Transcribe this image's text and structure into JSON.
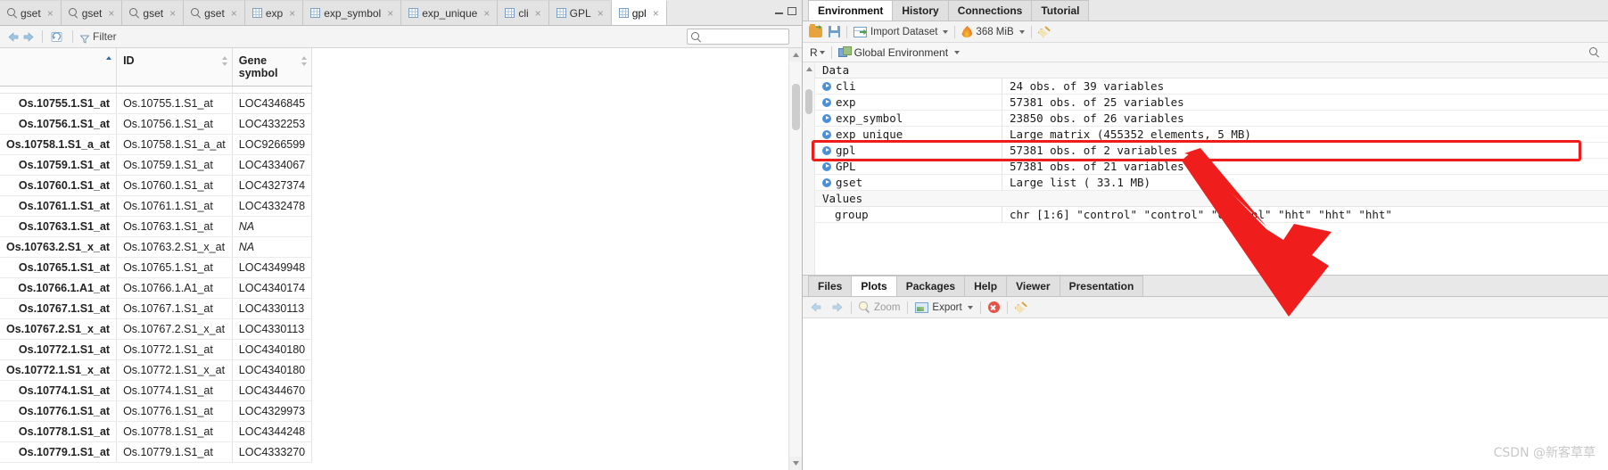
{
  "source_pane": {
    "tabs": [
      {
        "label": "gset",
        "icon": "search-icon",
        "active": false
      },
      {
        "label": "gset",
        "icon": "search-icon",
        "active": false
      },
      {
        "label": "gset",
        "icon": "search-icon",
        "active": false
      },
      {
        "label": "gset",
        "icon": "search-icon",
        "active": false
      },
      {
        "label": "exp",
        "icon": "grid-icon",
        "active": false
      },
      {
        "label": "exp_symbol",
        "icon": "grid-icon",
        "active": false
      },
      {
        "label": "exp_unique",
        "icon": "grid-icon",
        "active": false
      },
      {
        "label": "cli",
        "icon": "grid-icon",
        "active": false
      },
      {
        "label": "GPL",
        "icon": "grid-icon",
        "active": false
      },
      {
        "label": "gpl",
        "icon": "grid-icon",
        "active": true
      }
    ],
    "close_glyph": "×",
    "toolbar": {
      "filter_label": "Filter",
      "back_icon": "back-arrow-icon",
      "forward_icon": "forward-arrow-icon",
      "refresh_icon": "refresh-icon",
      "funnel_icon": "funnel-icon"
    },
    "search": {
      "value": "",
      "placeholder": ""
    },
    "window_controls": {
      "minimize": "minimize-icon",
      "maximize": "maximize-icon"
    },
    "grid": {
      "columns": [
        "",
        "ID",
        "Gene symbol"
      ],
      "sort_column": 0,
      "sort_direction": "asc",
      "rows": [
        {
          "rowname": "Os.10755.1.S1_at",
          "id": "Os.10755.1.S1_at",
          "symbol": "LOC4346845",
          "na": false
        },
        {
          "rowname": "Os.10756.1.S1_at",
          "id": "Os.10756.1.S1_at",
          "symbol": "LOC4332253",
          "na": false
        },
        {
          "rowname": "Os.10758.1.S1_a_at",
          "id": "Os.10758.1.S1_a_at",
          "symbol": "LOC9266599",
          "na": false
        },
        {
          "rowname": "Os.10759.1.S1_at",
          "id": "Os.10759.1.S1_at",
          "symbol": "LOC4334067",
          "na": false
        },
        {
          "rowname": "Os.10760.1.S1_at",
          "id": "Os.10760.1.S1_at",
          "symbol": "LOC4327374",
          "na": false
        },
        {
          "rowname": "Os.10761.1.S1_at",
          "id": "Os.10761.1.S1_at",
          "symbol": "LOC4332478",
          "na": false
        },
        {
          "rowname": "Os.10763.1.S1_at",
          "id": "Os.10763.1.S1_at",
          "symbol": "NA",
          "na": true
        },
        {
          "rowname": "Os.10763.2.S1_x_at",
          "id": "Os.10763.2.S1_x_at",
          "symbol": "NA",
          "na": true
        },
        {
          "rowname": "Os.10765.1.S1_at",
          "id": "Os.10765.1.S1_at",
          "symbol": "LOC4349948",
          "na": false
        },
        {
          "rowname": "Os.10766.1.A1_at",
          "id": "Os.10766.1.A1_at",
          "symbol": "LOC4340174",
          "na": false
        },
        {
          "rowname": "Os.10767.1.S1_at",
          "id": "Os.10767.1.S1_at",
          "symbol": "LOC4330113",
          "na": false
        },
        {
          "rowname": "Os.10767.2.S1_x_at",
          "id": "Os.10767.2.S1_x_at",
          "symbol": "LOC4330113",
          "na": false
        },
        {
          "rowname": "Os.10772.1.S1_at",
          "id": "Os.10772.1.S1_at",
          "symbol": "LOC4340180",
          "na": false
        },
        {
          "rowname": "Os.10772.1.S1_x_at",
          "id": "Os.10772.1.S1_x_at",
          "symbol": "LOC4340180",
          "na": false
        },
        {
          "rowname": "Os.10774.1.S1_at",
          "id": "Os.10774.1.S1_at",
          "symbol": "LOC4344670",
          "na": false
        },
        {
          "rowname": "Os.10776.1.S1_at",
          "id": "Os.10776.1.S1_at",
          "symbol": "LOC4329973",
          "na": false
        },
        {
          "rowname": "Os.10778.1.S1_at",
          "id": "Os.10778.1.S1_at",
          "symbol": "LOC4344248",
          "na": false
        },
        {
          "rowname": "Os.10779.1.S1_at",
          "id": "Os.10779.1.S1_at",
          "symbol": "LOC4333270",
          "na": false
        }
      ]
    }
  },
  "environment_pane": {
    "tabs": [
      {
        "label": "Environment",
        "active": true
      },
      {
        "label": "History",
        "active": false
      },
      {
        "label": "Connections",
        "active": false
      },
      {
        "label": "Tutorial",
        "active": false
      }
    ],
    "toolbar": {
      "open_icon": "open-folder-icon",
      "save_icon": "save-icon",
      "import_label": "Import Dataset",
      "import_icon": "import-dataset-icon",
      "memory_label": "368 MiB",
      "memory_icon": "memory-flame-icon",
      "clear_icon": "broom-icon"
    },
    "scope": {
      "language": "R",
      "environment_label": "Global Environment",
      "environment_icon": "cube-icon",
      "search_icon": "search-icon"
    },
    "sections": [
      {
        "name": "Data",
        "items": [
          {
            "name": "cli",
            "value": "24 obs. of 39 variables",
            "expandable": true,
            "highlighted": false
          },
          {
            "name": "exp",
            "value": "57381 obs. of 25 variables",
            "expandable": true,
            "highlighted": false
          },
          {
            "name": "exp_symbol",
            "value": "23850 obs. of 26 variables",
            "expandable": true,
            "highlighted": false
          },
          {
            "name": "exp_unique",
            "value": "Large matrix (455352 elements,  5 MB)",
            "expandable": true,
            "highlighted": false
          },
          {
            "name": "gpl",
            "value": "57381 obs. of 2 variables",
            "expandable": true,
            "highlighted": true
          },
          {
            "name": "GPL",
            "value": "57381 obs. of 21 variables",
            "expandable": true,
            "highlighted": false
          },
          {
            "name": "gset",
            "value": "Large list ( 33.1 MB)",
            "expandable": true,
            "highlighted": false
          }
        ]
      },
      {
        "name": "Values",
        "items": [
          {
            "name": "group",
            "value": "chr [1:6] \"control\" \"control\" \"control\" \"hht\" \"hht\" \"hht\"",
            "expandable": false,
            "highlighted": false
          }
        ]
      }
    ]
  },
  "plots_pane": {
    "tabs": [
      {
        "label": "Files",
        "active": false
      },
      {
        "label": "Plots",
        "active": true
      },
      {
        "label": "Packages",
        "active": false
      },
      {
        "label": "Help",
        "active": false
      },
      {
        "label": "Viewer",
        "active": false
      },
      {
        "label": "Presentation",
        "active": false
      }
    ],
    "toolbar": {
      "back_icon": "back-arrow-icon",
      "forward_icon": "forward-arrow-icon",
      "zoom_label": "Zoom",
      "zoom_icon": "zoom-icon",
      "export_label": "Export",
      "export_icon": "export-icon",
      "clear_icon": "clear-plot-icon",
      "broom_icon": "broom-icon"
    }
  },
  "annotation": {
    "highlight_color": "#ef1c1c",
    "arrow_name": "red-pointer-arrow"
  },
  "watermark": {
    "text": "CSDN @新客草草"
  }
}
